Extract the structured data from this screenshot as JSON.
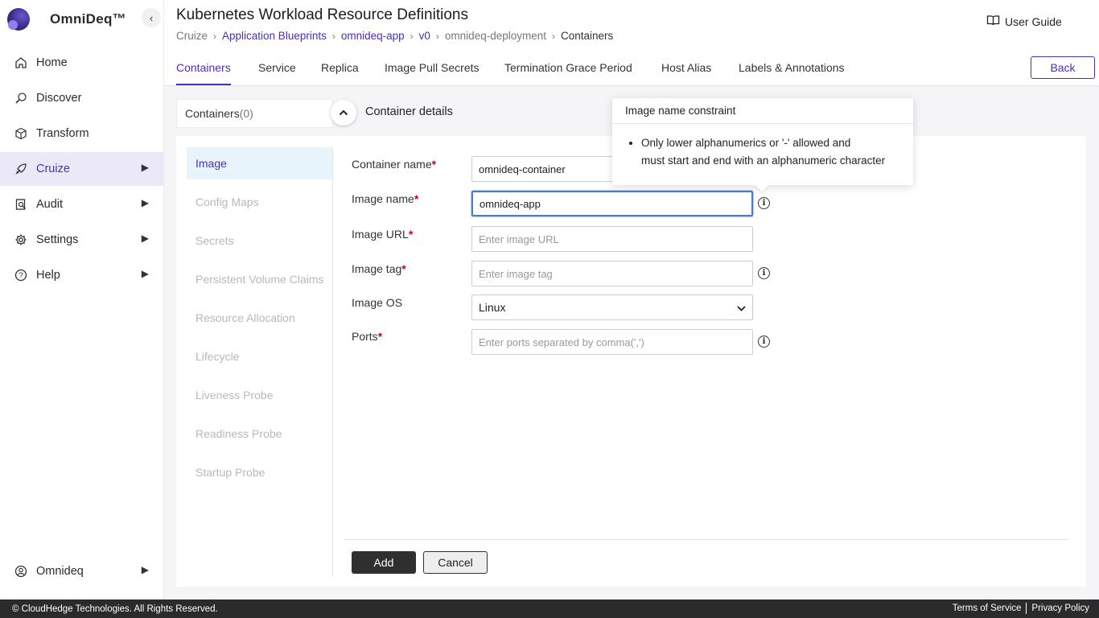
{
  "app": {
    "name": "OmniDeq™",
    "collapse_icon": "chevron-left-icon"
  },
  "sidebar": {
    "items": [
      {
        "label": "Home",
        "icon": "home-icon",
        "has_chevron": false
      },
      {
        "label": "Discover",
        "icon": "discover-icon",
        "has_chevron": false
      },
      {
        "label": "Transform",
        "icon": "cube-icon",
        "has_chevron": false
      },
      {
        "label": "Cruize",
        "icon": "cruize-icon",
        "has_chevron": true,
        "active": true
      },
      {
        "label": "Audit",
        "icon": "audit-icon",
        "has_chevron": true
      },
      {
        "label": "Settings",
        "icon": "gear-icon",
        "has_chevron": true
      },
      {
        "label": "Help",
        "icon": "help-icon",
        "has_chevron": true
      }
    ],
    "user": {
      "label": "Omnideq",
      "icon": "user-icon"
    }
  },
  "header": {
    "title": "Kubernetes Workload Resource Definitions",
    "breadcrumb": [
      "Cruize",
      "Application Blueprints",
      "omnideq-app",
      "v0",
      "omnideq-deployment",
      "Containers"
    ],
    "user_guide": "User Guide"
  },
  "tabs": {
    "items": [
      "Containers",
      "Service",
      "Replica",
      "Image Pull Secrets",
      "Termination Grace Period",
      "Host Alias",
      "Labels & Annotations"
    ],
    "active": "Containers",
    "back_label": "Back"
  },
  "containers": {
    "title": "Containers",
    "count": "(0)",
    "details_title": "Container details"
  },
  "subnav": {
    "items": [
      "Image",
      "Config Maps",
      "Secrets",
      "Persistent Volume Claims",
      "Resource Allocation",
      "Lifecycle",
      "Liveness Probe",
      "Readiness Probe",
      "Startup Probe"
    ],
    "active": "Image"
  },
  "form": {
    "container_name": {
      "label": "Container name",
      "value": "omnideq-container",
      "placeholder": ""
    },
    "image_name": {
      "label": "Image name",
      "value": "omnideq-app",
      "placeholder": ""
    },
    "image_url": {
      "label": "Image URL",
      "value": "",
      "placeholder": "Enter image URL"
    },
    "image_tag": {
      "label": "Image tag",
      "value": "",
      "placeholder": "Enter image tag"
    },
    "image_os": {
      "label": "Image OS",
      "value": "Linux"
    },
    "ports": {
      "label": "Ports",
      "value": "",
      "placeholder": "Enter ports separated by comma(',')"
    },
    "required_mark": "*",
    "add_label": "Add",
    "cancel_label": "Cancel"
  },
  "tooltip": {
    "title": "Image name constraint",
    "line1": "Only lower alphanumerics or '-' allowed and",
    "line2": "must start and end with an alphanumeric character"
  },
  "footer": {
    "copyright": "© CloudHedge Technologies. All Rights Reserved.",
    "terms": "Terms of Service",
    "privacy": "Privacy Policy"
  },
  "colors": {
    "accent": "#4b2fb6",
    "active_bg": "#ebe8f7",
    "footer_bg": "#2b2b2b"
  }
}
